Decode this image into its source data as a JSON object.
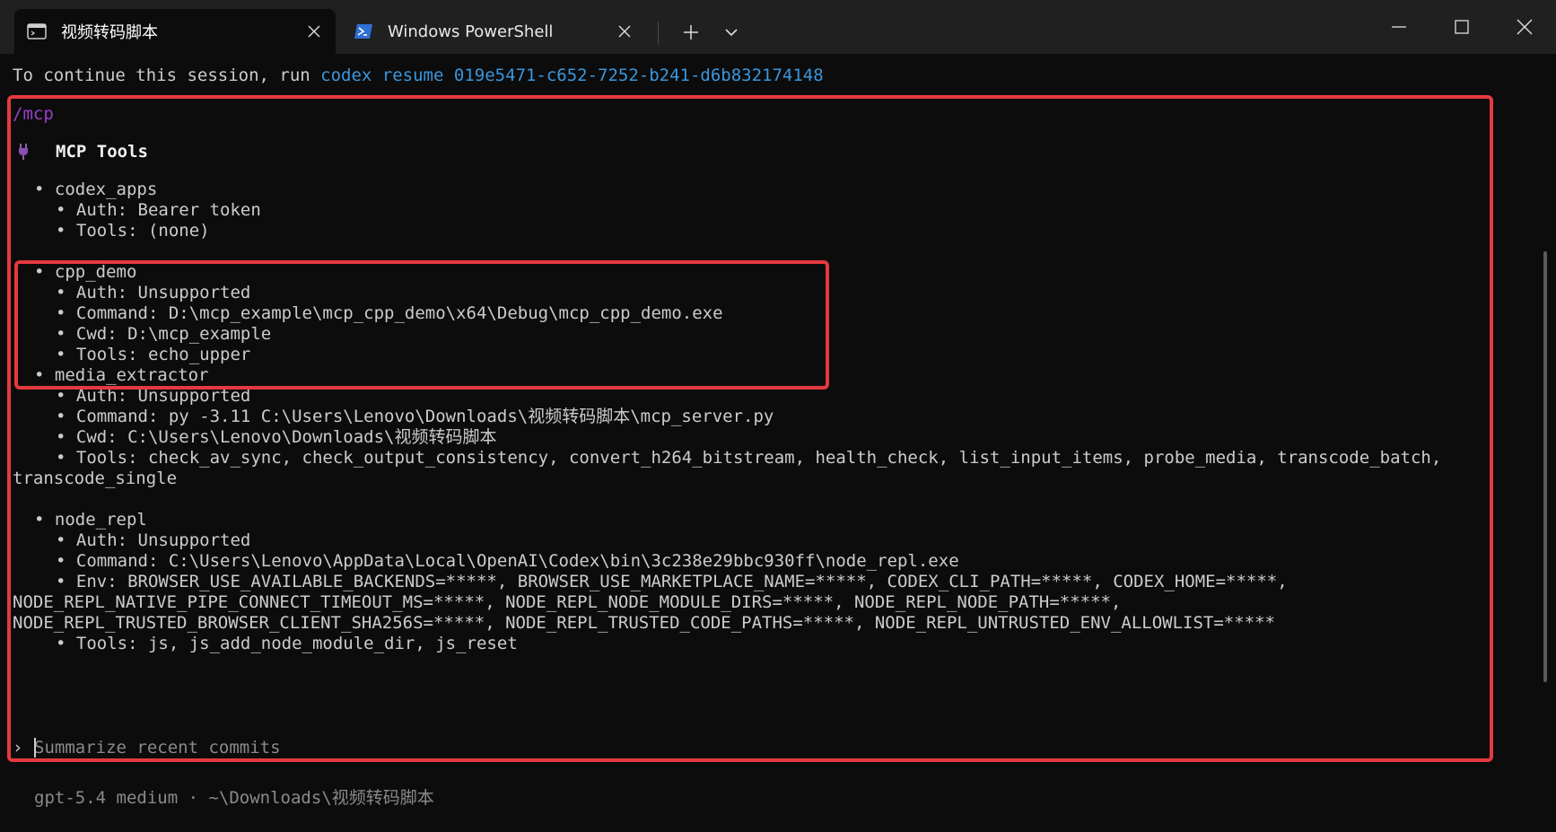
{
  "tabs": [
    {
      "label": "视频转码脚本",
      "icon": "terminal-icon",
      "active": true
    },
    {
      "label": "Windows PowerShell",
      "icon": "powershell-icon",
      "active": false
    }
  ],
  "session": {
    "prefix": "To continue this session, run ",
    "command": "codex resume 019e5471-c652-7252-b241-d6b832174148"
  },
  "slash_command": "/mcp",
  "heading": "MCP Tools",
  "servers": [
    {
      "name": "• codex_apps",
      "lines": [
        "• Auth: Bearer token",
        "• Tools: (none)"
      ]
    },
    {
      "name": "• cpp_demo",
      "lines": [
        "• Auth: Unsupported",
        "• Command: D:\\mcp_example\\mcp_cpp_demo\\x64\\Debug\\mcp_cpp_demo.exe",
        "• Cwd: D:\\mcp_example",
        "• Tools: echo_upper"
      ]
    },
    {
      "name": "• media_extractor",
      "lines": [
        "• Auth: Unsupported",
        "• Command: py -3.11 C:\\Users\\Lenovo\\Downloads\\视频转码脚本\\mcp_server.py",
        "• Cwd: C:\\Users\\Lenovo\\Downloads\\视频转码脚本",
        "• Tools: check_av_sync, check_output_consistency, convert_h264_bitstream, health_check, list_input_items, probe_media, transcode_batch,"
      ],
      "wrap": "transcode_single"
    },
    {
      "name": "• node_repl",
      "lines": [
        "• Auth: Unsupported",
        "• Command: C:\\Users\\Lenovo\\AppData\\Local\\OpenAI\\Codex\\bin\\3c238e29bbc930ff\\node_repl.exe",
        "• Env: BROWSER_USE_AVAILABLE_BACKENDS=*****, BROWSER_USE_MARKETPLACE_NAME=*****, CODEX_CLI_PATH=*****, CODEX_HOME=*****,"
      ],
      "wraps": [
        "NODE_REPL_NATIVE_PIPE_CONNECT_TIMEOUT_MS=*****, NODE_REPL_NODE_MODULE_DIRS=*****, NODE_REPL_NODE_PATH=*****,",
        "NODE_REPL_TRUSTED_BROWSER_CLIENT_SHA256S=*****, NODE_REPL_TRUSTED_CODE_PATHS=*****, NODE_REPL_UNTRUSTED_ENV_ALLOWLIST=*****"
      ],
      "last": "• Tools: js, js_add_node_module_dir, js_reset"
    }
  ],
  "prompt": {
    "caret": "›",
    "placeholder": "Summarize recent commits"
  },
  "status": "gpt-5.4 medium · ~\\Downloads\\视频转码脚本",
  "colors": {
    "highlight": "#e5393f",
    "command": "#9a3fc9",
    "link": "#3a96dd",
    "background": "#0c0c0c"
  }
}
